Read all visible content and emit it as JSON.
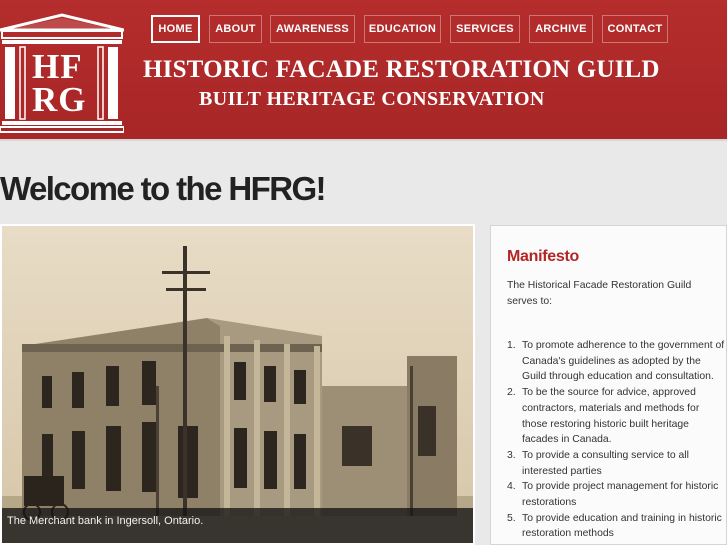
{
  "logo": {
    "line1": "HF",
    "line2": "RG"
  },
  "header": {
    "title": "HISTORIC FACADE RESTORATION GUILD",
    "subtitle": "BUILT HERITAGE CONSERVATION"
  },
  "nav": {
    "items": [
      "HOME",
      "ABOUT",
      "AWARENESS",
      "EDUCATION",
      "SERVICES",
      "ARCHIVE",
      "CONTACT"
    ],
    "active": "HOME"
  },
  "main": {
    "welcome": "Welcome to the HFRG!",
    "photo_caption": "The Merchant bank in Ingersoll, Ontario."
  },
  "sidebar": {
    "title": "Manifesto",
    "intro": "The Historical Facade Restoration Guild serves to:",
    "items": [
      "To promote adherence to the government of Canada's guidelines as adopted by the Guild through education and consultation.",
      "To be the source for advice, approved contractors, materials and methods for those restoring historic built heritage facades in Canada.",
      "To provide a consulting service to all interested parties",
      "To provide project management for historic restorations",
      "To provide education and training in historic restoration methods"
    ]
  },
  "colors": {
    "brand": "#b02a2a",
    "accent": "#b32626",
    "background": "#e9e9e9"
  }
}
